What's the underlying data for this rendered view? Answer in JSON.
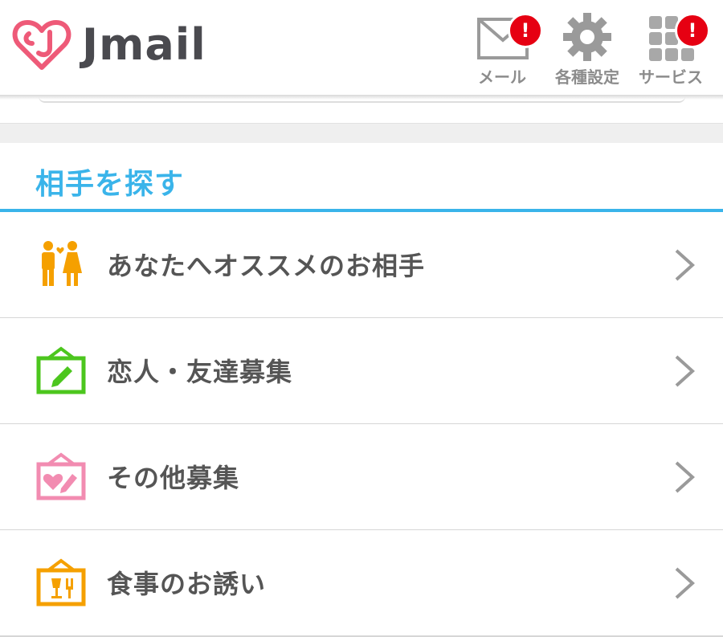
{
  "header": {
    "logo_text": "Jmail",
    "buttons": [
      {
        "label": "メール",
        "icon": "mail-icon",
        "badge": "!"
      },
      {
        "label": "各種設定",
        "icon": "gear-icon",
        "badge": ""
      },
      {
        "label": "サービス",
        "icon": "grid-icon",
        "badge": "!"
      }
    ]
  },
  "section": {
    "title": "相手を探す",
    "items": [
      {
        "label": "あなたへオススメのお相手",
        "icon": "couple-icon",
        "color": "#f5a000"
      },
      {
        "label": "恋人・友達募集",
        "icon": "green-board-icon",
        "color": "#4cc61e"
      },
      {
        "label": "その他募集",
        "icon": "pink-board-icon",
        "color": "#f28cb1"
      },
      {
        "label": "食事のお誘い",
        "icon": "meal-board-icon",
        "color": "#f5a000"
      }
    ]
  },
  "colors": {
    "accent": "#3ab4ea",
    "badge": "#e60012",
    "logo": "#ee5a78"
  }
}
